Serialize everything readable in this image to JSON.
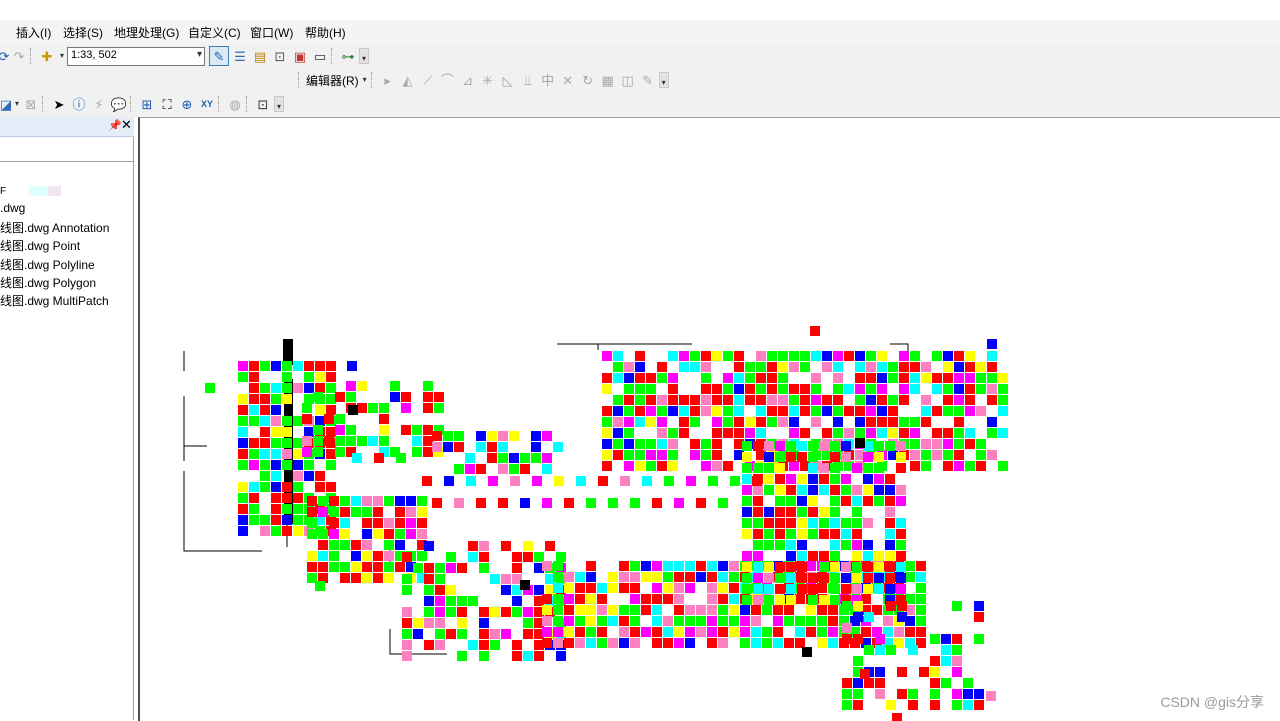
{
  "menu": [
    "插入(I)",
    "选择(S)",
    "地理处理(G)",
    "自定义(C)",
    "窗口(W)",
    "帮助(H)"
  ],
  "standard_toolbar": {
    "scale_value": "1:33, 502",
    "icons": [
      "redo-icon",
      "add-data-icon",
      "editor-toolbar-icon",
      "toc-window-icon",
      "catalog-icon",
      "search-window-icon",
      "arctoolbox-icon",
      "python-icon",
      "model-builder-icon"
    ]
  },
  "editor_toolbar": {
    "label": "编辑器(R)"
  },
  "tools_toolbar": {
    "icons": [
      "select-elements-icon",
      "identify-icon",
      "html-popup-icon",
      "hyperlink-icon",
      "measure-icon",
      "find-icon",
      "find-route-icon",
      "go-to-xy-icon",
      "time-slider-icon",
      "magnifier-icon"
    ]
  },
  "toc": {
    "items": [
      {
        "label": "F"
      },
      {
        "label": ".dwg"
      },
      {
        "label": "线图.dwg Annotation"
      },
      {
        "label": "线图.dwg Point"
      },
      {
        "label": "线图.dwg Polyline"
      },
      {
        "label": "线图.dwg Polygon"
      },
      {
        "label": "线图.dwg MultiPatch"
      }
    ]
  },
  "watermark": "CSDN @gis分享",
  "colors": {
    "red": "#ff0000",
    "green": "#00ff00",
    "blue": "#0000ff",
    "magenta": "#ff00ff",
    "yellow": "#ffff00",
    "cyan": "#00ffff",
    "pink": "#ff80c0",
    "black": "#000000"
  }
}
